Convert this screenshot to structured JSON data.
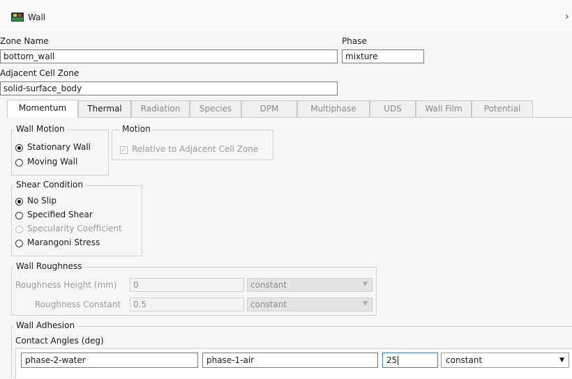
{
  "window": {
    "title": "Wall",
    "close_glyph": "›",
    "icon": "wall-icon"
  },
  "zone_name": {
    "label": "Zone Name",
    "value": "bottom_wall"
  },
  "phase": {
    "label": "Phase",
    "value": "mixture"
  },
  "adjacent_cell_zone": {
    "label": "Adjacent Cell Zone",
    "value": "solid-surface_body"
  },
  "tabs": [
    {
      "label": "Momentum",
      "active": true
    },
    {
      "label": "Thermal"
    },
    {
      "label": "Radiation"
    },
    {
      "label": "Species"
    },
    {
      "label": "DPM"
    },
    {
      "label": "Multiphase"
    },
    {
      "label": "UDS"
    },
    {
      "label": "Wall Film"
    },
    {
      "label": "Potential"
    }
  ],
  "wall_motion": {
    "legend": "Wall Motion",
    "options": [
      "Stationary Wall",
      "Moving Wall"
    ],
    "selected": "Stationary Wall"
  },
  "motion": {
    "legend": "Motion",
    "relative_label": "Relative to Adjacent Cell Zone",
    "relative_checked": true
  },
  "shear_condition": {
    "legend": "Shear Condition",
    "options": [
      "No Slip",
      "Specified Shear",
      "Specularity Coefficient",
      "Marangoni Stress"
    ],
    "selected": "No Slip"
  },
  "wall_roughness": {
    "legend": "Wall Roughness",
    "height_label": "Roughness Height (mm)",
    "height_value": "0",
    "height_method": "constant",
    "constant_label": "Roughness Constant",
    "constant_value": "0.5",
    "constant_method": "constant"
  },
  "wall_adhesion": {
    "legend": "Wall Adhesion",
    "contact_angles_label": "Contact Angles (deg)",
    "phase_a": "phase-2-water",
    "phase_b": "phase-1-air",
    "angle_value": "25",
    "angle_method": "constant"
  },
  "colors": {
    "accent": "#3a7bd5",
    "background": "#f6f6f6"
  }
}
